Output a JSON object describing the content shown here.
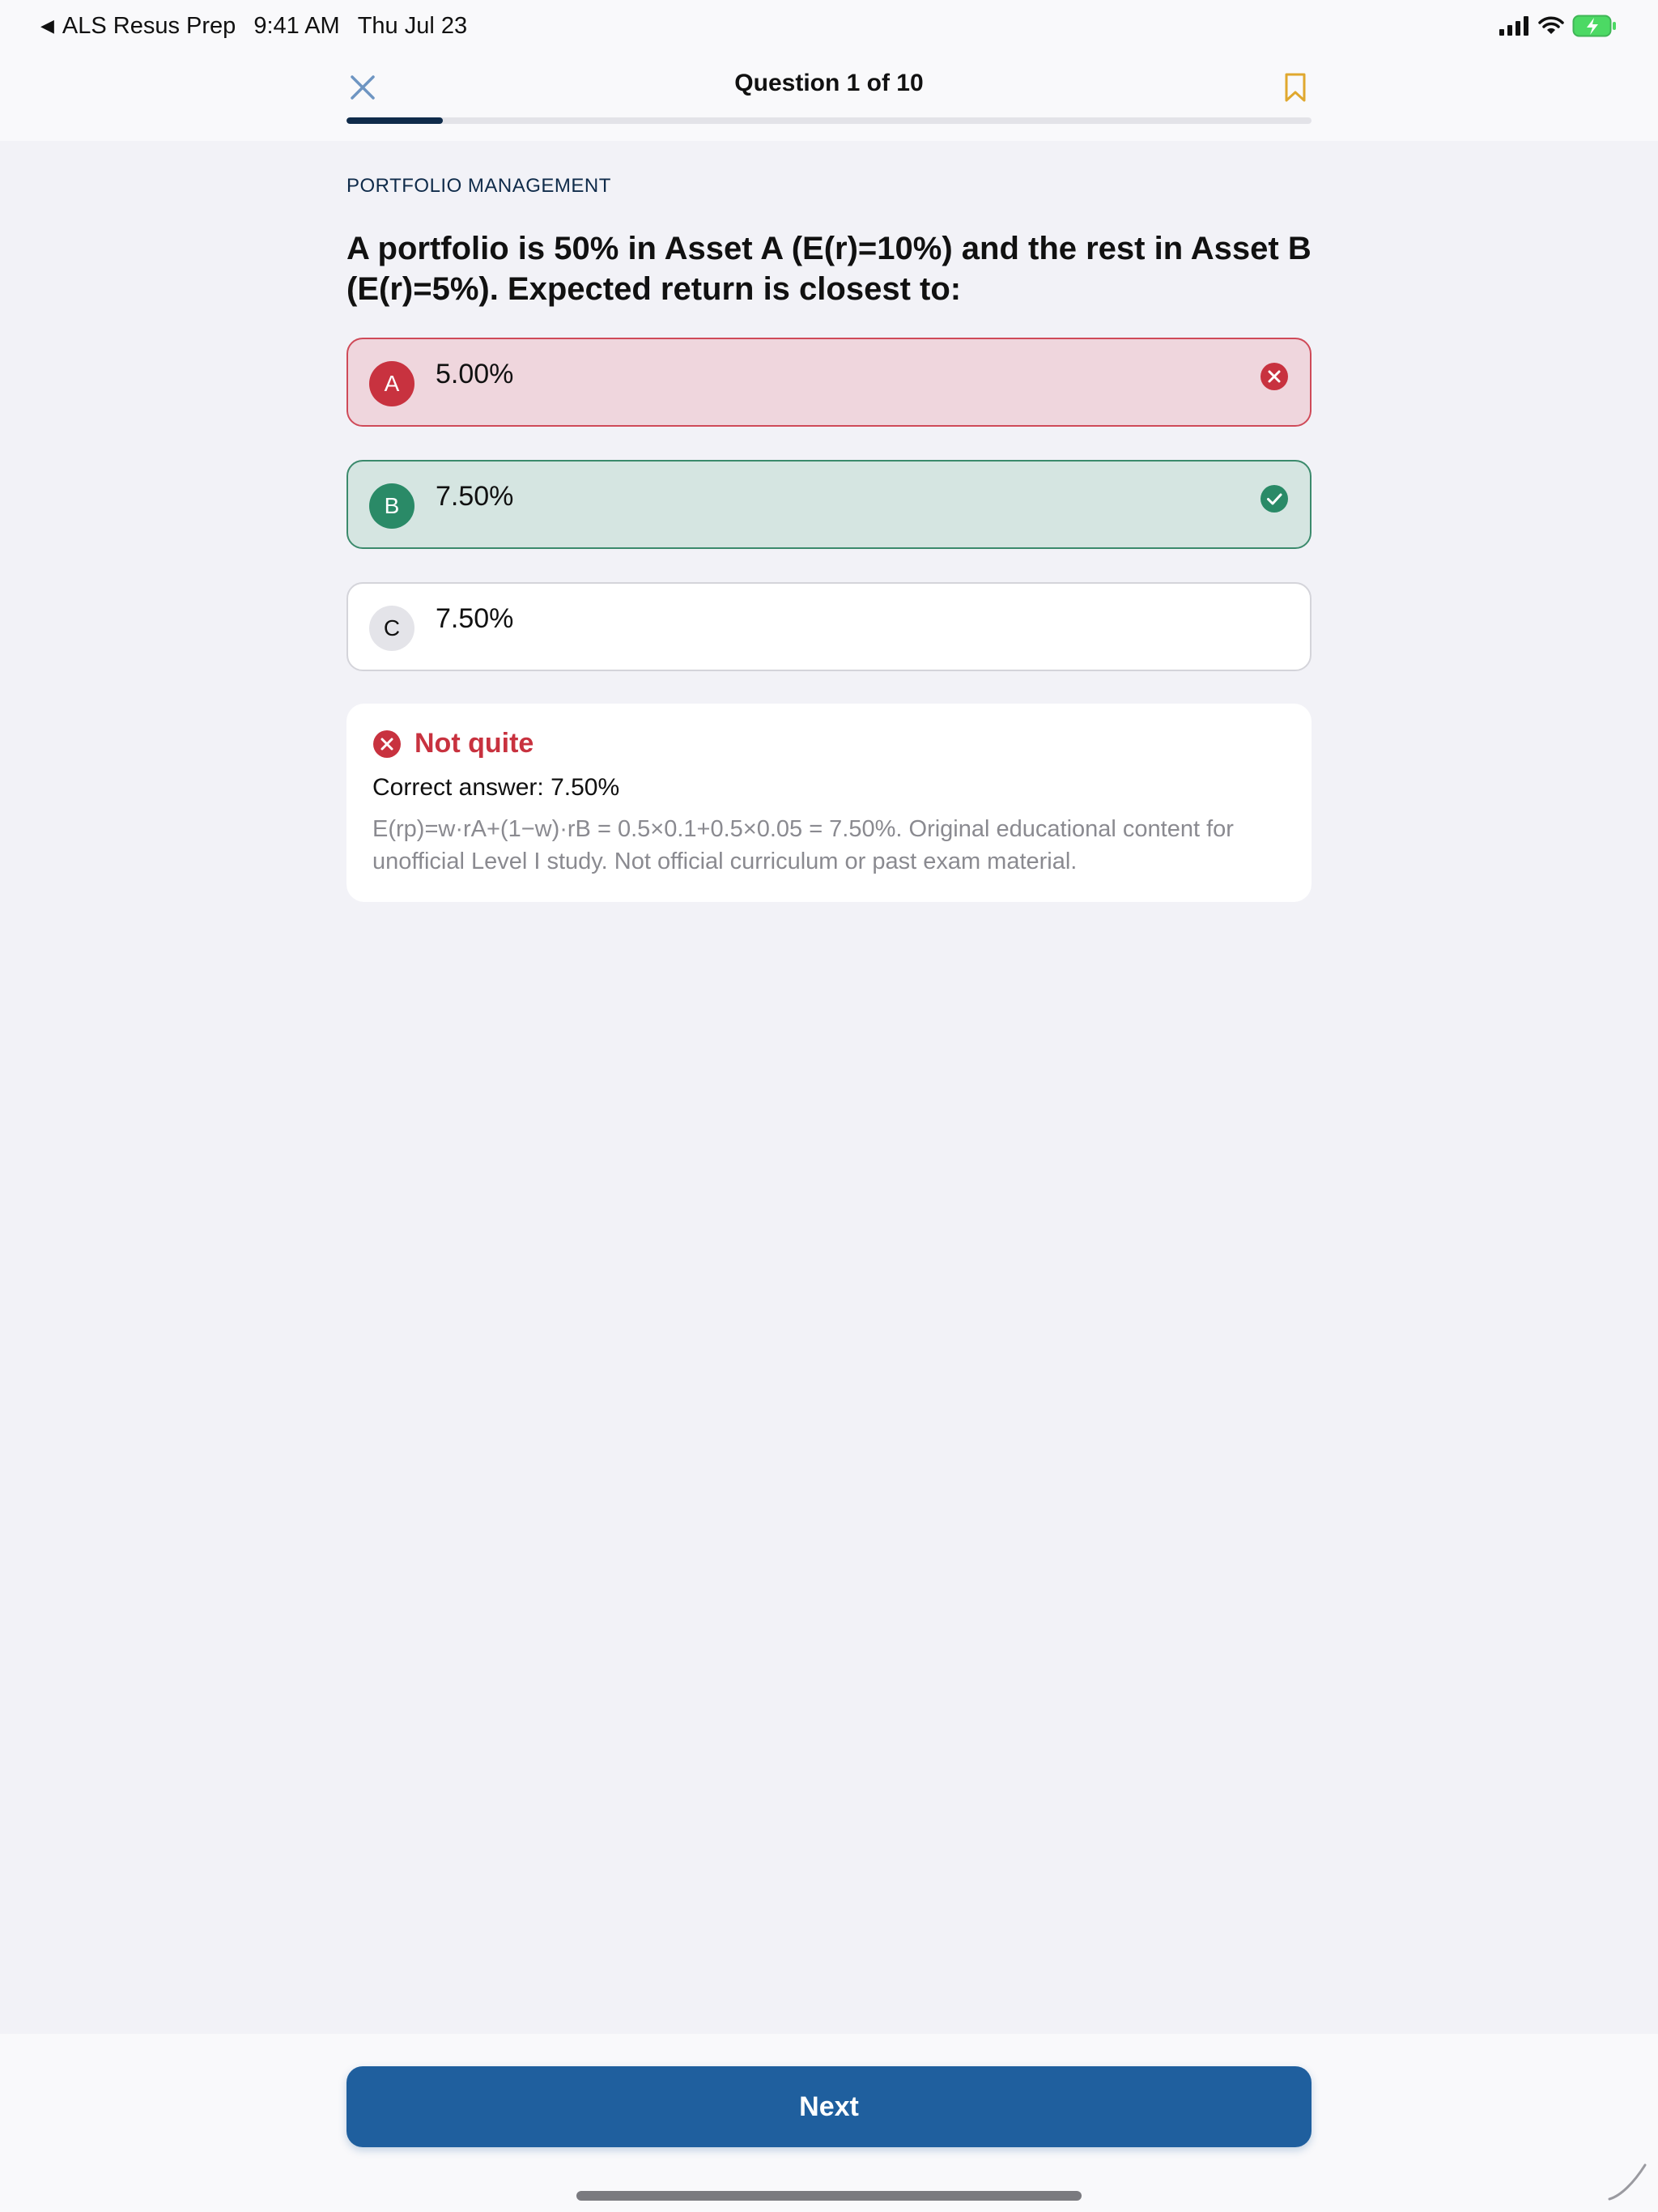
{
  "status_bar": {
    "back_app": "ALS Resus Prep",
    "time": "9:41 AM",
    "date": "Thu Jul 23"
  },
  "nav": {
    "title": "Question 1 of 10",
    "progress": 0.1
  },
  "question": {
    "category": "PORTFOLIO MANAGEMENT",
    "text": "A portfolio is 50% in Asset A (E(r)=10%) and the rest in Asset B (E(r)=5%). Expected return is closest to:"
  },
  "options": [
    {
      "letter": "A",
      "text": "5.00%",
      "state": "wrong"
    },
    {
      "letter": "B",
      "text": "7.50%",
      "state": "correct"
    },
    {
      "letter": "C",
      "text": "7.50%",
      "state": "neutral"
    }
  ],
  "feedback": {
    "title": "Not quite",
    "correct_answer": "Correct answer: 7.50%",
    "explanation": "E(rp)=w·rA+(1−w)·rB = 0.5×0.1+0.5×0.05 = 7.50%. Original educational content for unofficial Level I study. Not official curriculum or past exam material."
  },
  "footer": {
    "next_label": "Next"
  },
  "colors": {
    "primary": "#1f5f9e",
    "wrong": "#c8323f",
    "correct": "#2a8a67",
    "bookmark": "#e0a82e"
  }
}
